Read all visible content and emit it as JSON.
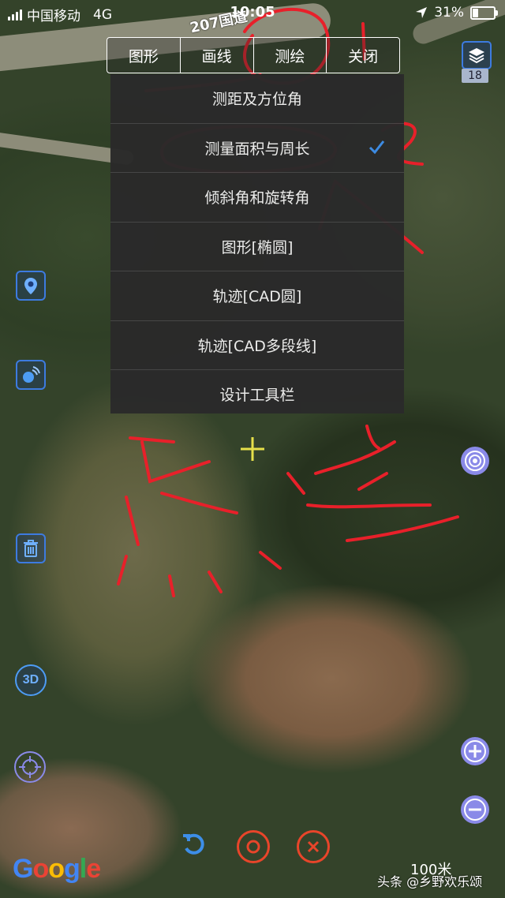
{
  "status_bar": {
    "carrier": "中国移动",
    "network": "4G",
    "time": "10:05",
    "battery": "31%",
    "battery_level": 0.31
  },
  "map": {
    "road_label": "207国道",
    "scale_label": "100米",
    "zoom_level": "18",
    "attribution": "Google"
  },
  "tabs": [
    {
      "label": "图形"
    },
    {
      "label": "画线"
    },
    {
      "label": "测绘"
    },
    {
      "label": "关闭"
    }
  ],
  "menu": {
    "items": [
      {
        "label": "测距及方位角"
      },
      {
        "label": "测量面积与周长",
        "selected": true
      },
      {
        "label": "倾斜角和旋转角"
      },
      {
        "label": "图形[椭圆]"
      },
      {
        "label": "轨迹[CAD圆]"
      },
      {
        "label": "轨迹[CAD多段线]"
      },
      {
        "label": "设计工具栏"
      }
    ]
  },
  "side_buttons": {
    "left": [
      "location-pin-icon",
      "gps-signal-icon",
      "trash-icon",
      "3d-icon",
      "crosshair-target-icon"
    ],
    "right": [
      "target-icon",
      "zoom-in-icon",
      "zoom-out-icon"
    ],
    "three_d_label": "3D"
  },
  "bottom_toolbar": [
    "undo-icon",
    "record-icon",
    "cancel-icon"
  ],
  "watermark": "头条 @乡野欢乐颂",
  "colors": {
    "accent": "#3d7be0",
    "purple_button": "#8a8ae8",
    "menu_bg": "#2a2a2a",
    "annotation_red": "#e8202a",
    "crosshair": "#e6e04a"
  }
}
